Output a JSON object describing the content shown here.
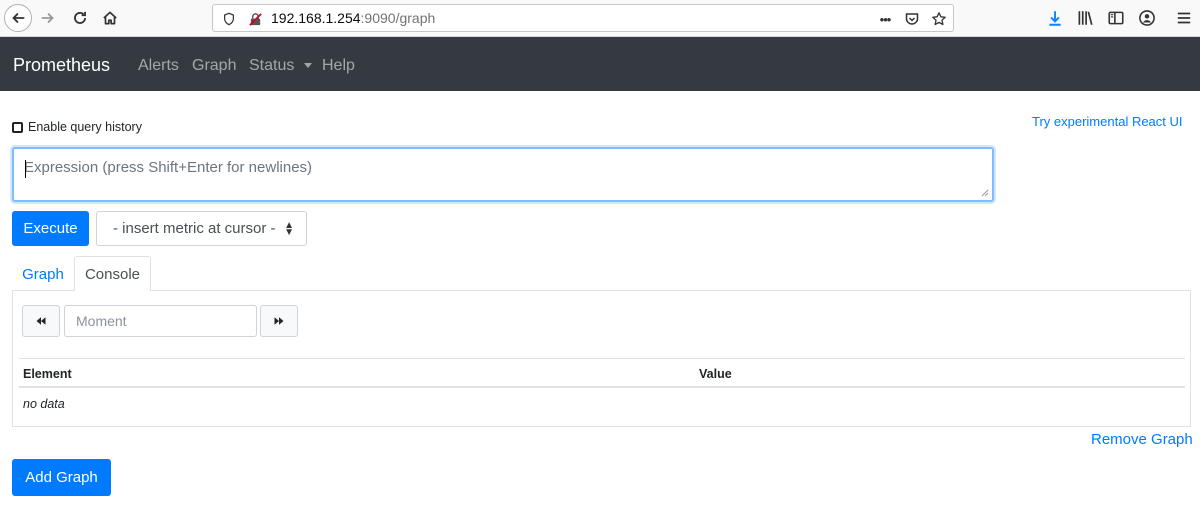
{
  "browser": {
    "url_host": "192.168.1.254",
    "url_path": ":9090/graph",
    "icons": [
      "back-icon",
      "forward-icon",
      "reload-icon",
      "home-icon",
      "shield-icon",
      "insecure-lock-icon",
      "more-icon",
      "pocket-icon",
      "bookmark-star-icon",
      "download-icon",
      "library-icon",
      "sidebar-icon",
      "account-icon",
      "menu-icon"
    ],
    "url_more": "•••"
  },
  "navbar": {
    "brand": "Prometheus",
    "items": [
      "Alerts",
      "Graph",
      "Status",
      "Help"
    ]
  },
  "query": {
    "history_label": "Enable query history",
    "react_link": "Try experimental React UI",
    "placeholder": "Expression (press Shift+Enter for newlines)",
    "execute_label": "Execute",
    "metric_select": "- insert metric at cursor -"
  },
  "tabs": [
    "Graph",
    "Console"
  ],
  "console": {
    "moment_placeholder": "Moment",
    "columns": [
      "Element",
      "Value"
    ],
    "empty": "no data"
  },
  "actions": {
    "remove_graph": "Remove Graph",
    "add_graph": "Add Graph"
  },
  "colors": {
    "accent": "#007bff",
    "navbar": "#343a40"
  }
}
